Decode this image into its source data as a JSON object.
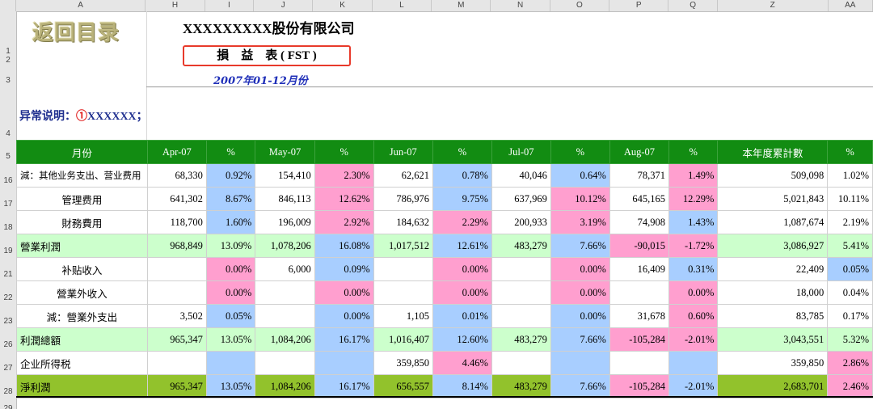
{
  "columns": [
    "A",
    "H",
    "I",
    "J",
    "K",
    "L",
    "M",
    "N",
    "O",
    "P",
    "Q",
    "Z",
    "AA"
  ],
  "rows": [
    "1",
    "2",
    "3",
    "4",
    "5",
    "16",
    "17",
    "18",
    "19",
    "21",
    "22",
    "23",
    "26",
    "27",
    "28",
    "29"
  ],
  "return_link": "返回目录",
  "company": "XXXXXXXXX股份有限公司",
  "title": "損　益　表 ( FST )",
  "period": "2007年01-12月份",
  "note": {
    "label": "异常说明：",
    "mark": "①",
    "code": "XXXXXX",
    "end": "；"
  },
  "header": [
    "月份",
    "Apr-07",
    "%",
    "May-07",
    "%",
    "Jun-07",
    "%",
    "Jul-07",
    "%",
    "Aug-07",
    "%",
    "本年度累計數",
    "%"
  ],
  "table_rows": [
    {
      "cells": [
        "減：其他业务支出、营业费用",
        "68,330",
        "0.92%",
        "154,410",
        "2.30%",
        "62,621",
        "0.78%",
        "40,046",
        "0.64%",
        "78,371",
        "1.49%",
        "509,098",
        "1.02%"
      ]
    },
    {
      "cells": [
        "管理费用",
        "641,302",
        "8.67%",
        "846,113",
        "12.62%",
        "786,976",
        "9.75%",
        "637,969",
        "10.12%",
        "645,165",
        "12.29%",
        "5,021,843",
        "10.11%"
      ]
    },
    {
      "cells": [
        "財務費用",
        "118,700",
        "1.60%",
        "196,009",
        "2.92%",
        "184,632",
        "2.29%",
        "200,933",
        "3.19%",
        "74,908",
        "1.43%",
        "1,087,674",
        "2.19%"
      ]
    },
    {
      "cells": [
        "營業利潤",
        "968,849",
        "13.09%",
        "1,078,206",
        "16.08%",
        "1,017,512",
        "12.61%",
        "483,279",
        "7.66%",
        "-90,015",
        "-1.72%",
        "3,086,927",
        "5.41%"
      ]
    },
    {
      "cells": [
        "补贴收入",
        "",
        "0.00%",
        "6,000",
        "0.09%",
        "",
        "0.00%",
        "",
        "0.00%",
        "16,409",
        "0.31%",
        "22,409",
        "0.05%"
      ]
    },
    {
      "cells": [
        "營業外收入",
        "",
        "0.00%",
        "",
        "0.00%",
        "",
        "0.00%",
        "",
        "0.00%",
        "",
        "0.00%",
        "18,000",
        "0.04%"
      ]
    },
    {
      "cells": [
        "減：營業外支出",
        "3,502",
        "0.05%",
        "",
        "0.00%",
        "1,105",
        "0.01%",
        "",
        "0.00%",
        "31,678",
        "0.60%",
        "83,785",
        "0.17%"
      ]
    },
    {
      "cells": [
        "利潤總額",
        "965,347",
        "13.05%",
        "1,084,206",
        "16.17%",
        "1,016,407",
        "12.60%",
        "483,279",
        "7.66%",
        "-105,284",
        "-2.01%",
        "3,043,551",
        "5.32%"
      ]
    },
    {
      "cells": [
        "企业所得税",
        "",
        "",
        "",
        "",
        "359,850",
        "4.46%",
        "",
        "",
        "",
        "",
        "359,850",
        "2.86%"
      ]
    },
    {
      "cells": [
        "淨利潤",
        "965,347",
        "13.05%",
        "1,084,206",
        "16.17%",
        "656,557",
        "8.14%",
        "483,279",
        "7.66%",
        "-105,284",
        "-2.01%",
        "2,683,701",
        "2.46%"
      ]
    }
  ],
  "colors": {
    "header_bg": "#128c12",
    "subtotal_bg": "#ccffcc",
    "net_bg": "#92c22c",
    "blue_cell": "#a8ceff",
    "pink_cell": "#ff9fcf",
    "title_border": "#e83a2b"
  }
}
